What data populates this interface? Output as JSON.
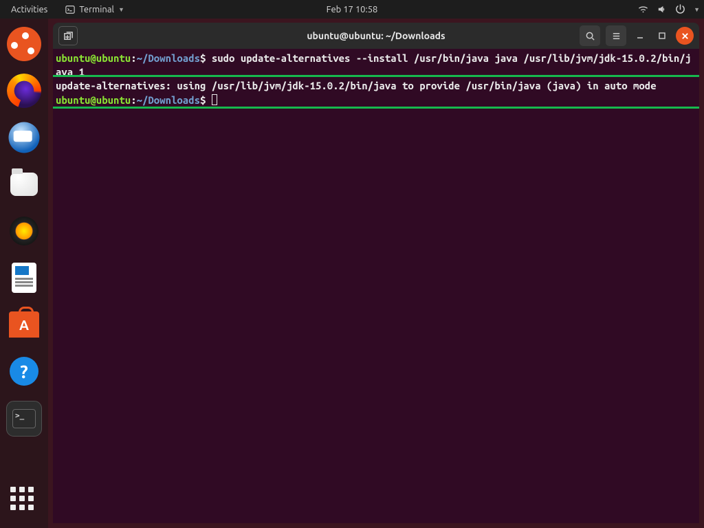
{
  "topbar": {
    "activities": "Activities",
    "appmenu": "Terminal",
    "clock": "Feb 17  10:58"
  },
  "dock": {
    "items": [
      {
        "name": "ubuntu-logo"
      },
      {
        "name": "firefox"
      },
      {
        "name": "thunderbird"
      },
      {
        "name": "files"
      },
      {
        "name": "rhythmbox"
      },
      {
        "name": "libreoffice-writer"
      },
      {
        "name": "ubuntu-software"
      },
      {
        "name": "help"
      },
      {
        "name": "terminal-running"
      }
    ]
  },
  "terminal": {
    "title": "ubuntu@ubuntu: ~/Downloads",
    "lines": {
      "l1_user": "ubuntu@ubuntu",
      "l1_sep": ":",
      "l1_path": "~/Downloads",
      "l1_dollar": "$ ",
      "l1_cmd": "sudo update-alternatives --install /usr/bin/java java /usr/lib/jvm/jdk-15.0.2/bin/java 1",
      "l2_out": "update-alternatives: using /usr/lib/jvm/jdk-15.0.2/bin/java to provide /usr/bin/java (java) in auto mode",
      "l3_user": "ubuntu@ubuntu",
      "l3_sep": ":",
      "l3_path": "~/Downloads",
      "l3_dollar": "$ "
    },
    "newtab_glyph": "⧉"
  }
}
